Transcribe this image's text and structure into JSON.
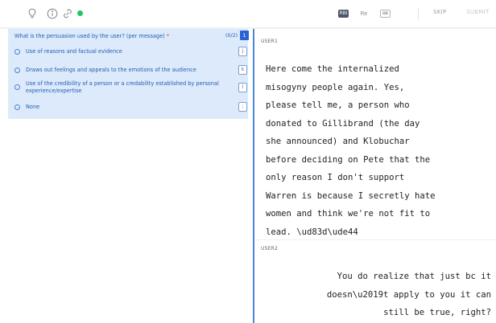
{
  "toolbar": {
    "icons": [
      "lightbulb-icon",
      "info-icon",
      "link-icon",
      "status-dot-icon"
    ],
    "chip_dark": "RBI",
    "chip_text": "Re",
    "chip_light": "⌨",
    "skip_label": "SKIP",
    "submit_label": "SUBMIT",
    "status_color": "#22c55e"
  },
  "question": {
    "text": "What is the persuasion used by the user? (per message)",
    "required_mark": "*",
    "count": "(0/2)",
    "number": "1",
    "options": [
      {
        "label": "Use of reasons and factual evidence",
        "key": "j"
      },
      {
        "label": "Draws out feelings and appeals to the emotions of the audience",
        "key": "k"
      },
      {
        "label": "Use of the credibility of a person or a credability established by personal experience/expertise",
        "key": "l"
      },
      {
        "label": "None",
        "key": ";"
      }
    ]
  },
  "messages": [
    {
      "user": "USER1",
      "text": "Here come the internalized\nmisogyny people again. Yes,\nplease tell me, a person who\ndonated to Gillibrand (the day\nshe announced) and Klobuchar\nbefore deciding on Pete that the\nonly reason I don't support\nWarren is because I secretly hate\nwomen and think we're not fit to\nlead. \\ud83d\\ude44"
    },
    {
      "user": "USER2",
      "text": "You do realize that just bc it\ndoesn\\u2019t apply to you it can\nstill be true, right?"
    }
  ],
  "colors": {
    "accent": "#2a63d3",
    "panel_bg": "#ddeafc",
    "text_blue": "#1f5db0",
    "divider": "#4a86d6"
  }
}
